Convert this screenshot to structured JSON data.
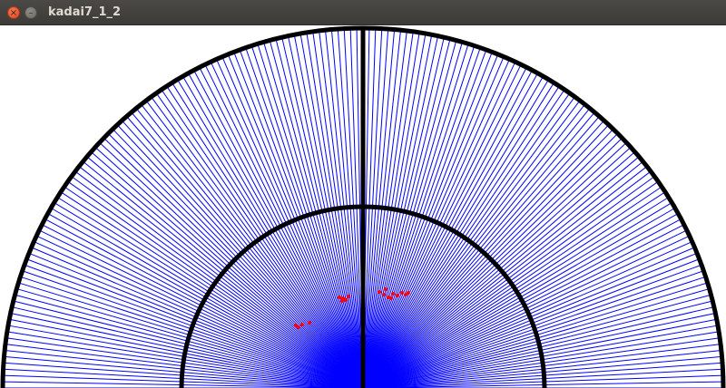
{
  "window": {
    "title": "kadai7_1_2",
    "close_glyph": "×",
    "minimize_glyph": "–"
  },
  "icons": {
    "close": "close-icon",
    "minimize": "minimize-icon"
  },
  "colors": {
    "beam": "#0000ff",
    "outline": "#000000",
    "points": "#ff0000",
    "titlebar": "#3c3b37",
    "title_text": "#dfdbd2"
  },
  "scan": {
    "beam_count": 181,
    "angle_range_deg": [
      0,
      180
    ],
    "range_circles": 2
  }
}
